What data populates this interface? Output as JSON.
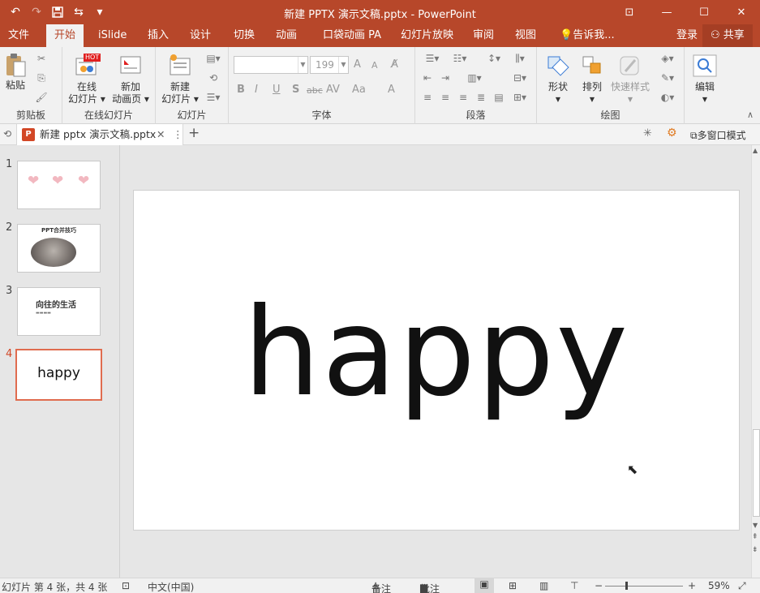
{
  "app": {
    "title": "新建 PPTX 演示文稿.pptx - PowerPoint",
    "accent": "#b7472a"
  },
  "qat": {
    "undo": "↶",
    "redo": "↷",
    "save": "💾",
    "touch": "⇆",
    "more": "▾"
  },
  "window_controls": {
    "ribbon_opts": "⊡",
    "minimize": "—",
    "maximize": "☐",
    "close": "✕"
  },
  "tabs": [
    {
      "label": "文件"
    },
    {
      "label": "开始"
    },
    {
      "label": "iSlide"
    },
    {
      "label": "插入"
    },
    {
      "label": "设计"
    },
    {
      "label": "切换"
    },
    {
      "label": "动画"
    },
    {
      "label": "口袋动画 PA"
    },
    {
      "label": "幻灯片放映"
    },
    {
      "label": "审阅"
    },
    {
      "label": "视图"
    },
    {
      "label": "告诉我..."
    }
  ],
  "account": {
    "login": "登录",
    "share": "共享"
  },
  "ribbon": {
    "groups": {
      "clipboard": "剪贴板",
      "online_slides": "在线幻灯片",
      "slides": "幻灯片",
      "font": "字体",
      "paragraph": "段落",
      "drawing": "绘图"
    },
    "buttons": {
      "paste": "粘贴",
      "online_slide_1": "在线",
      "online_slide_2": "幻灯片 ▾",
      "new_anim_1": "新加",
      "new_anim_2": "动画页 ▾",
      "new_slide_1": "新建",
      "new_slide_2": "幻灯片 ▾",
      "shape": "形状",
      "arrange": "排列",
      "quick_style": "快速样式",
      "edit": "编辑",
      "hot_badge": "HOT"
    },
    "font_name": "",
    "font_size": "199",
    "format": {
      "bold": "B",
      "italic": "I",
      "underline": "U",
      "shadow": "S",
      "strike": "abc",
      "spacing": "AV",
      "case": "Aa",
      "color": "A",
      "grow": "A",
      "shrink": "A"
    }
  },
  "doc_tab": {
    "label": "新建 pptx 演示文稿.pptx",
    "close": "✕",
    "menu": "⋮",
    "add": "+",
    "icon_letter": "P",
    "multi_window": "多窗口模式"
  },
  "slides": [
    {
      "number": "1",
      "content": "hearts",
      "hearts": [
        "❤",
        "❤",
        "❤"
      ],
      "heart_color": "#f2b8c0"
    },
    {
      "number": "2",
      "title": "PPT合并技巧"
    },
    {
      "number": "3",
      "title": "向往的生活",
      "subtitle": "▬▬▬▬"
    },
    {
      "number": "4",
      "title": "happy",
      "selected": true
    }
  ],
  "current_slide": {
    "text": "happy"
  },
  "status": {
    "slide_info": "幻灯片 第 4 张，共 4 张",
    "language": "中文(中国)",
    "notes": "备注",
    "comments": "批注",
    "zoom": "59%"
  }
}
